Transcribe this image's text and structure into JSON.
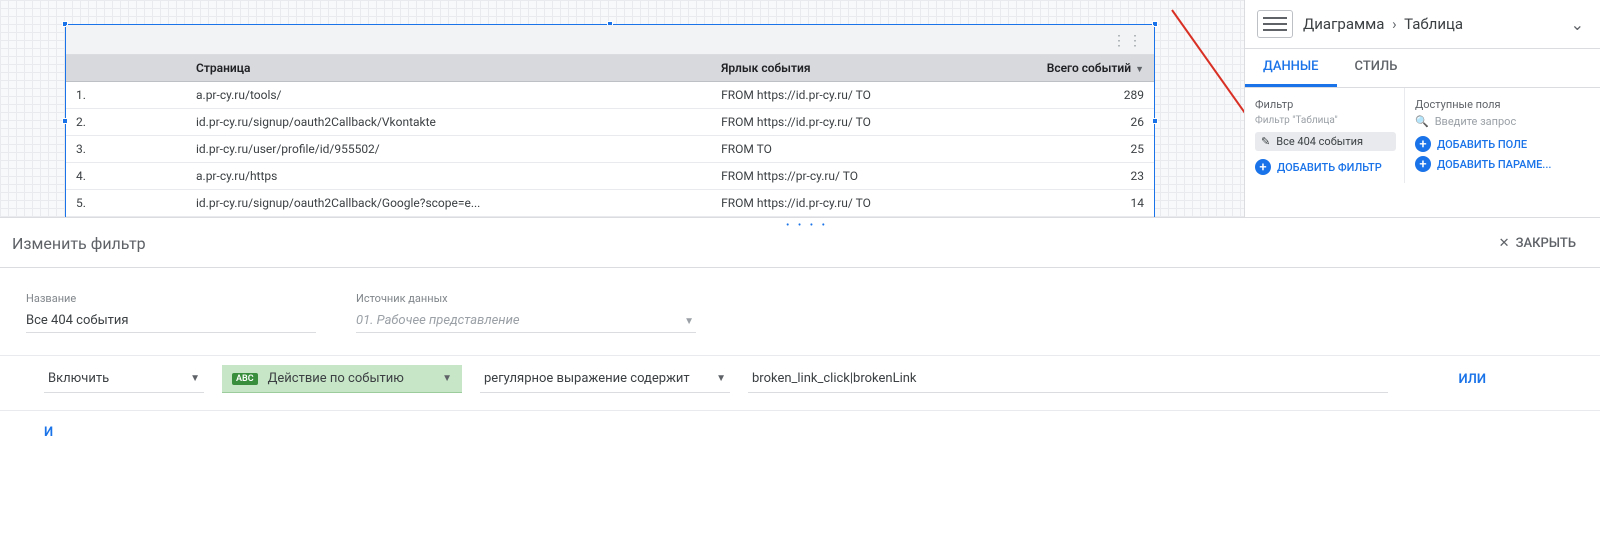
{
  "breadcrumb": {
    "root": "Диаграмма",
    "leaf": "Таблица"
  },
  "tabs": {
    "data": "ДАННЫЕ",
    "style": "СТИЛЬ"
  },
  "rightPanel": {
    "filterLabel": "Фильтр",
    "filterSub": "Фильтр \"Таблица\"",
    "filterChip": "Все 404 события",
    "addFilter": "ДОБАВИТЬ ФИЛЬТР",
    "availLabel": "Доступные поля",
    "searchPlaceholder": "Введите запрос",
    "addField": "ДОБАВИТЬ ПОЛЕ",
    "addParam": "ДОБАВИТЬ ПАРАМЕ..."
  },
  "table": {
    "headers": {
      "page": "Страница",
      "label": "Ярлык события",
      "total": "Всего событий"
    },
    "rows": [
      {
        "idx": "1.",
        "page": "a.pr-cy.ru/tools/",
        "label": "FROM https://id.pr-cy.ru/ TO",
        "total": "289"
      },
      {
        "idx": "2.",
        "page": "id.pr-cy.ru/signup/oauth2Callback/Vkontakte",
        "label": "FROM https://id.pr-cy.ru/ TO",
        "total": "26"
      },
      {
        "idx": "3.",
        "page": "id.pr-cy.ru/user/profile/id/955502/",
        "label": "FROM TO",
        "total": "25"
      },
      {
        "idx": "4.",
        "page": "a.pr-cy.ru/https",
        "label": "FROM https://pr-cy.ru/ TO",
        "total": "23"
      },
      {
        "idx": "5.",
        "page": "id.pr-cy.ru/signup/oauth2Callback/Google?scope=e...",
        "label": "FROM https://id.pr-cy.ru/ TO",
        "total": "14"
      }
    ]
  },
  "editor": {
    "title": "Изменить фильтр",
    "close": "ЗАКРЫТЬ",
    "nameLabel": "Название",
    "nameValue": "Все 404 события",
    "dsLabel": "Источник данных",
    "dsValue": "01. Рабочее представление",
    "include": "Включить",
    "dimension": "Действие по событию",
    "abc": "ABC",
    "operator": "регулярное выражение содержит",
    "value": "broken_link_click|brokenLink",
    "or": "ИЛИ",
    "and": "И"
  }
}
